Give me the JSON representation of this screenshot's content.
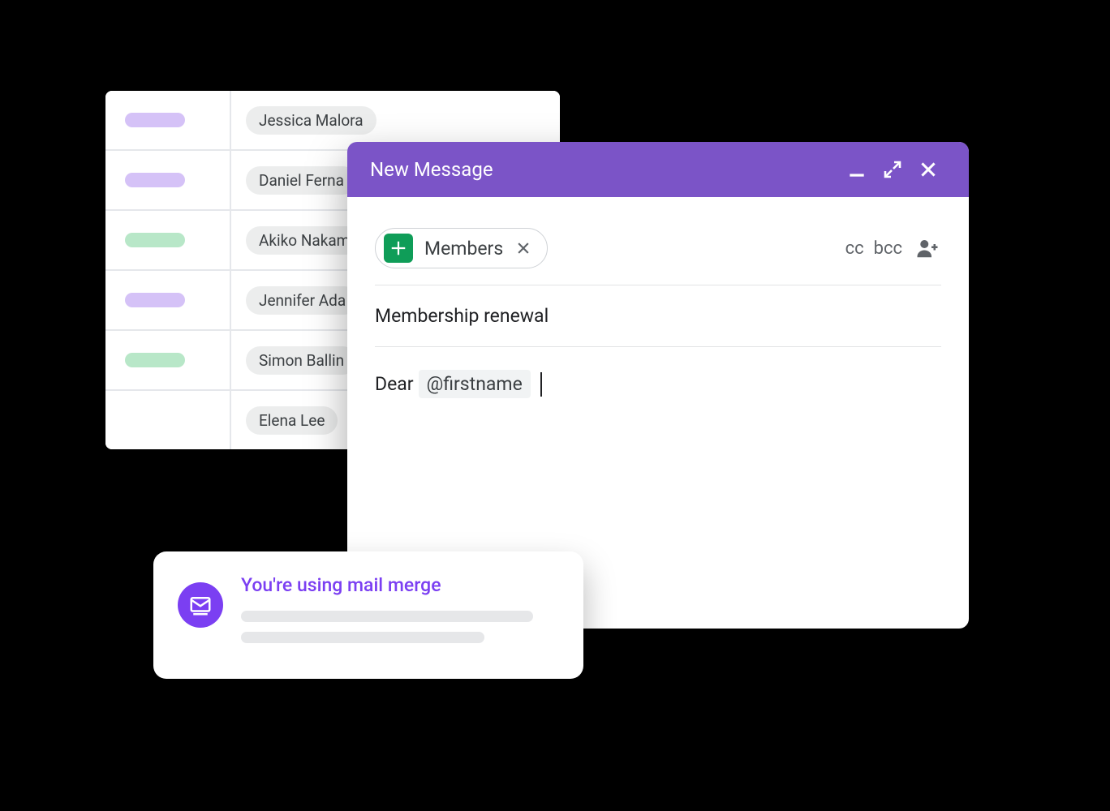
{
  "sheet": {
    "rows": [
      {
        "status": "purple",
        "name": "Jessica Malora"
      },
      {
        "status": "purple",
        "name": "Daniel Ferna"
      },
      {
        "status": "green",
        "name": "Akiko Nakam"
      },
      {
        "status": "purple",
        "name": "Jennifer Ada"
      },
      {
        "status": "green",
        "name": "Simon Ballin"
      },
      {
        "status": "",
        "name": "Elena Lee"
      }
    ]
  },
  "compose": {
    "title": "New Message",
    "recipient_chip": "Members",
    "cc": "cc",
    "bcc": "bcc",
    "subject": "Membership renewal",
    "body_prefix": "Dear",
    "merge_token": "@firstname"
  },
  "toast": {
    "title": "You're using mail merge"
  },
  "colors": {
    "accent": "#7b54c7",
    "toast_accent": "#7b3ff2",
    "sheets_green": "#0f9d58"
  }
}
